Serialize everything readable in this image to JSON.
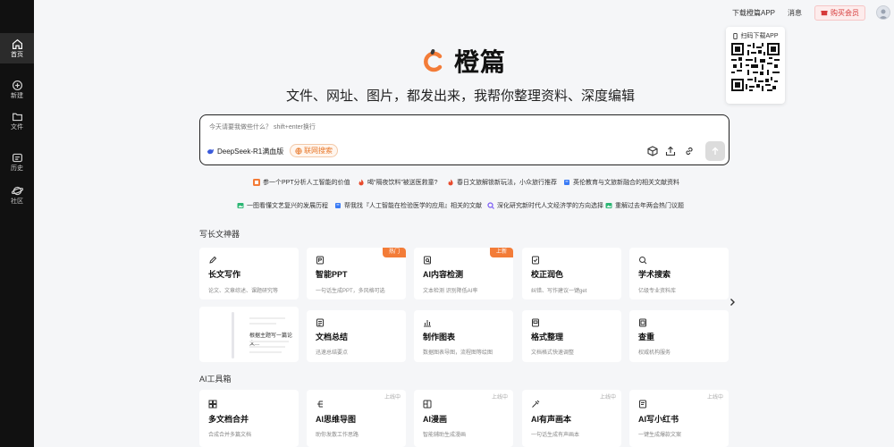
{
  "sidebar": {
    "items": [
      {
        "label": "首页",
        "icon": "home-icon",
        "active": true
      },
      {
        "label": "新建",
        "icon": "new-doc-icon"
      },
      {
        "label": "文件",
        "icon": "folder-icon"
      },
      {
        "label": "历史",
        "icon": "history-icon"
      },
      {
        "label": "社区",
        "icon": "community-icon"
      }
    ]
  },
  "topbar": {
    "download_app": "下载橙篇APP",
    "messages": "消息",
    "buy_vip": "购买会员"
  },
  "qr": {
    "title": "扫码下载APP"
  },
  "hero": {
    "brand": "橙篇",
    "slogan": "文件、网址、图片，都发出来，我帮你整理资料、深度编辑"
  },
  "input": {
    "placeholder": "今天请要我做些什么？ shift+enter换行",
    "model": "DeepSeek-R1满血版",
    "web_search": "联网搜索"
  },
  "suggestions": [
    "参一个PPT分析人工智能的价值",
    "喝“隔夜饮料”被送医救童?",
    "春日文旅解锁新玩法，小众旅行推荐",
    "英伦教育与文旅新融合的相关文献资料",
    "一图看懂文艺复兴的发展历程",
    "帮我找『人工智能在检验医学的应用』相关的文献",
    "深化研究新时代人文经济学的方向选择",
    "重解过去年两会热门议题"
  ],
  "sections": {
    "writing": "写长文神器",
    "tools": "AI工具箱"
  },
  "writing_cards": [
    {
      "title": "长文写作",
      "desc": "论文、文章综述、课题研究等",
      "icon": "pencil-icon"
    },
    {
      "title": "智能PPT",
      "desc": "一句话生成PPT，多风格可选",
      "icon": "ppt-icon",
      "badge": "热门"
    },
    {
      "title": "AI内容检测",
      "desc": "文本检测 识别降低AI率",
      "icon": "ai-detect-icon",
      "badge": "上新"
    },
    {
      "title": "校正润色",
      "desc": "纠错、写作建议一键get",
      "icon": "proofread-icon"
    },
    {
      "title": "学术搜索",
      "desc": "亿级专业资料库",
      "icon": "academic-search-icon"
    },
    {
      "title": "文档总结",
      "desc": "迅速总结要点",
      "icon": "summary-icon"
    },
    {
      "title": "制作图表",
      "desc": "数据图表导图，流程图等绘图",
      "icon": "chart-icon"
    },
    {
      "title": "格式整理",
      "desc": "文档格式快速调整",
      "icon": "format-icon"
    },
    {
      "title": "查重",
      "desc": "权威机构服务",
      "icon": "plagiarism-icon"
    }
  ],
  "preview": {
    "text": "根据主题写一篇论文..."
  },
  "tool_cards": [
    {
      "title": "多文档合并",
      "desc": "合成合并多篇文档",
      "icon": "merge-icon"
    },
    {
      "title": "AI思维导图",
      "desc": "助你发散工作思路",
      "icon": "mindmap-icon",
      "soon": "上线中"
    },
    {
      "title": "AI漫画",
      "desc": "智能辅助生成漫画",
      "icon": "comic-icon",
      "soon": "上线中"
    },
    {
      "title": "AI有声画本",
      "desc": "一句话生成有声画本",
      "icon": "audiobook-icon",
      "soon": "上线中"
    },
    {
      "title": "AI写小红书",
      "desc": "一键生成爆款文案",
      "icon": "xiaohongshu-icon",
      "soon": "上线中"
    }
  ],
  "colors": {
    "accent": "#f37c38",
    "sidebar": "#111111",
    "vip": "#d63a3a"
  }
}
